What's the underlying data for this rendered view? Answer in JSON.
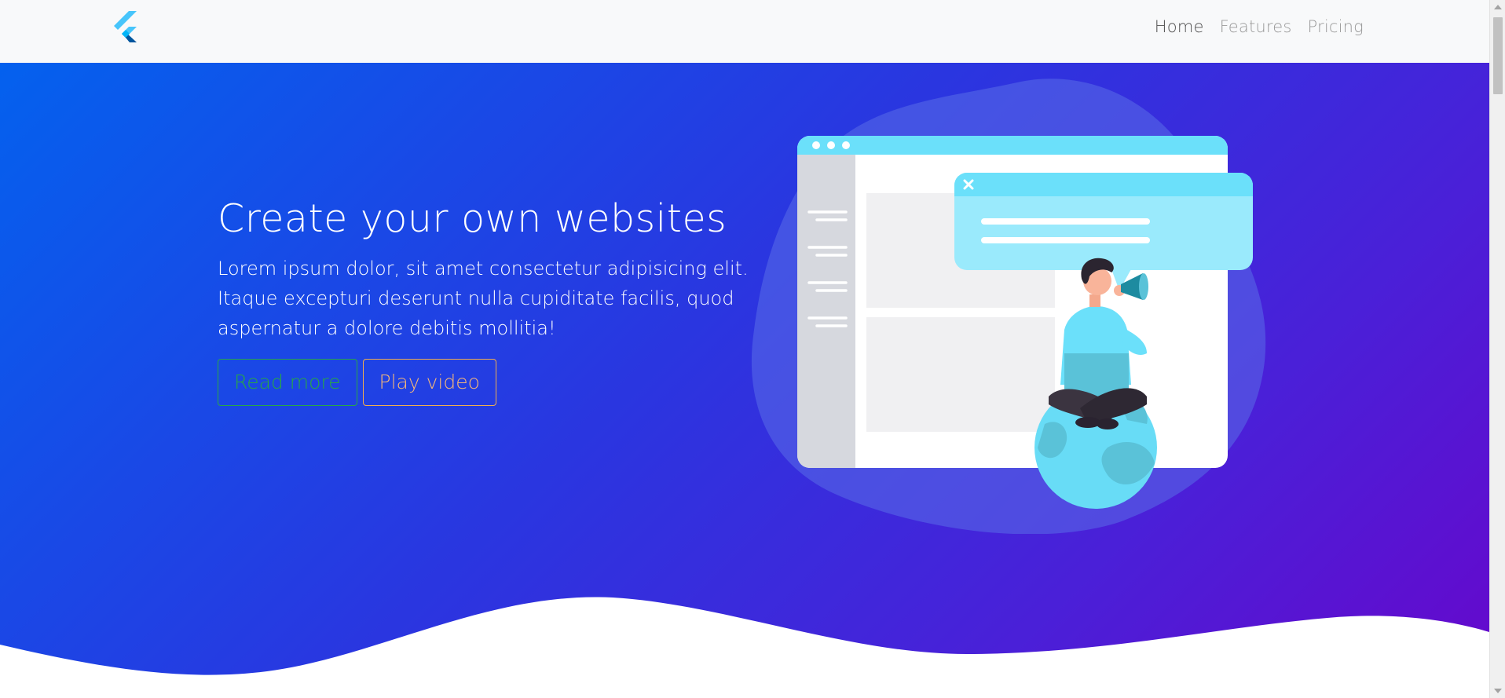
{
  "navbar": {
    "logo_icon": "flutter-logo",
    "links": [
      {
        "label": "Home",
        "active": true
      },
      {
        "label": "Features",
        "active": false
      },
      {
        "label": "Pricing",
        "active": false
      }
    ]
  },
  "hero": {
    "title": "Create your own websites",
    "description": "Lorem ipsum dolor, sit amet consectetur adipisicing elit. Itaque excepturi deserunt nulla cupiditate facilis, quod aspernatur a dolore debitis mollitia!",
    "buttons": {
      "read_more": "Read more",
      "play_video": "Play video"
    },
    "gradient": [
      "#0461ee",
      "#6608cc"
    ],
    "illustration": "person-with-megaphone-on-globe"
  },
  "colors": {
    "read_more_border": "#28a745",
    "play_video_border": "#f0ad4e",
    "nav_background": "#f8f9fa"
  }
}
